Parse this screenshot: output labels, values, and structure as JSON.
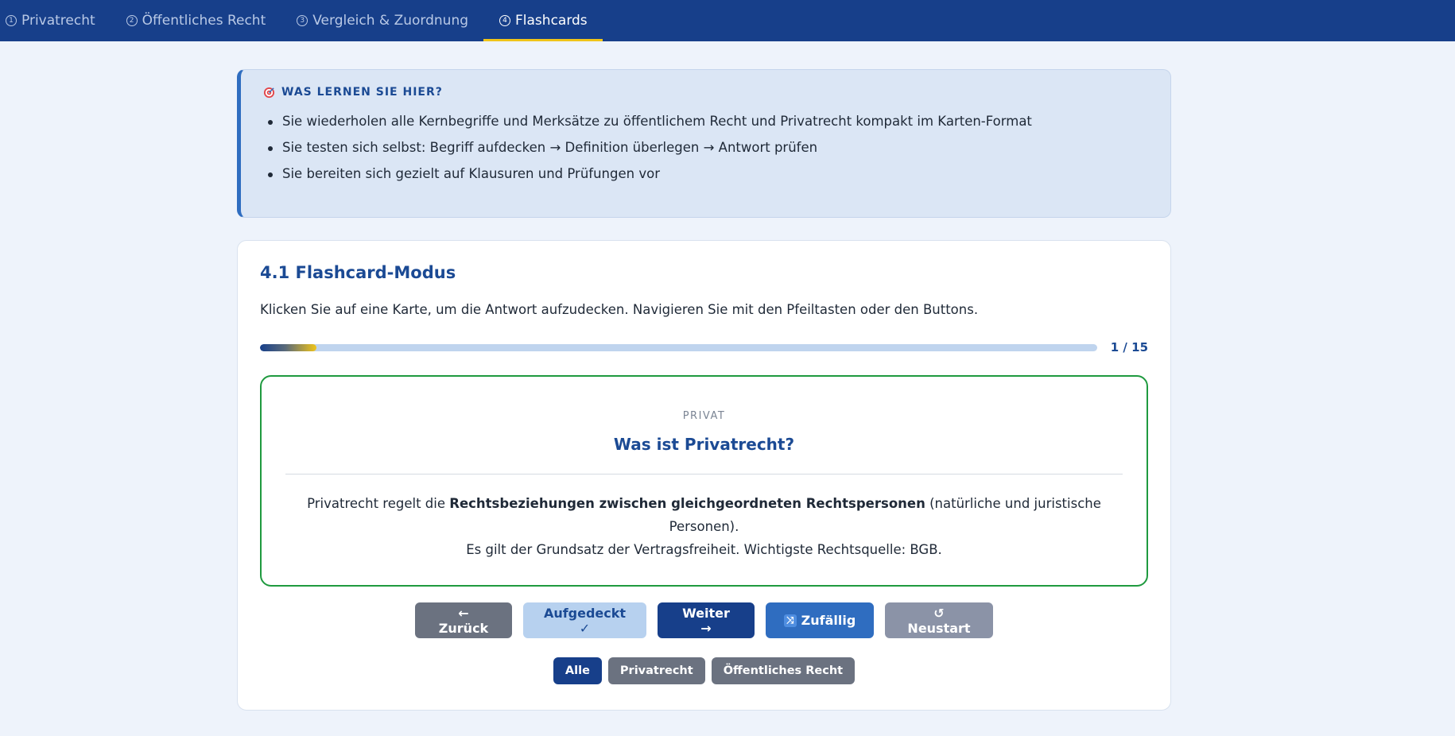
{
  "nav": {
    "tabs": [
      {
        "num": "1",
        "label": "Privatrecht"
      },
      {
        "num": "2",
        "label": "Öffentliches Recht"
      },
      {
        "num": "3",
        "label": "Vergleich & Zuordnung"
      },
      {
        "num": "4",
        "label": "Flashcards"
      }
    ],
    "active_index": 3
  },
  "info": {
    "icon": "target-icon",
    "title": "WAS LERNEN SIE HIER?",
    "items": [
      "Sie wiederholen alle Kernbegriffe und Merksätze zu öffentlichem Recht und Privatrecht kompakt im Karten-Format",
      "Sie testen sich selbst: Begriff aufdecken → Definition überlegen → Antwort prüfen",
      "Sie bereiten sich gezielt auf Klausuren und Prüfungen vor"
    ]
  },
  "card": {
    "title": "4.1 Flashcard-Modus",
    "description": "Klicken Sie auf eine Karte, um die Antwort aufzudecken. Navigieren Sie mit den Pfeiltasten oder den Buttons.",
    "progress": {
      "current": 1,
      "total": 15,
      "label": "1 / 15",
      "fill_fraction": 0.067
    }
  },
  "flashcard": {
    "category": "PRIVAT",
    "question": "Was ist Privatrecht?",
    "answer_pre": "Privatrecht regelt die ",
    "answer_bold": "Rechtsbeziehungen zwischen gleichgeordneten Rechtspersonen",
    "answer_post": " (natürliche und juristische Personen).",
    "answer_line2": "Es gilt der Grundsatz der Vertragsfreiheit. Wichtigste Rechtsquelle: BGB.",
    "border_color": "#1f9a3f"
  },
  "buttons": {
    "back": "← Zurück",
    "revealed": "Aufgedeckt ✓",
    "next": "Weiter →",
    "random": "Zufällig",
    "restart": "↺ Neustart"
  },
  "filters": {
    "all": "Alle",
    "private": "Privatrecht",
    "public": "Öffentliches Recht",
    "active": "all"
  },
  "colors": {
    "nav_bg": "#173f8a",
    "accent_yellow": "#f0c419",
    "primary": "#1b4a94"
  }
}
